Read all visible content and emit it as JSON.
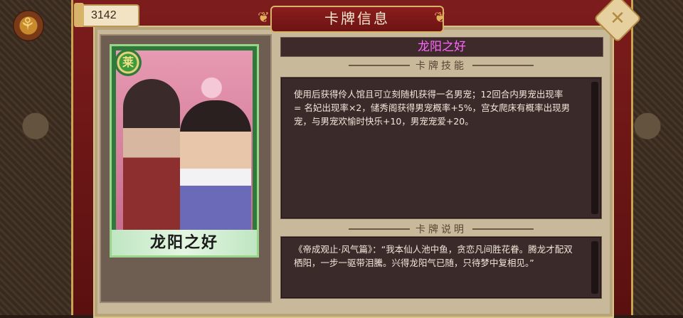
{
  "currency": {
    "amount": "3142"
  },
  "header": {
    "title": "卡牌信息"
  },
  "card": {
    "name": "龙阳之好",
    "badge": "莱",
    "skill_heading": "卡牌技能",
    "skill_text": "使用后获得伶人馆且可立刻随机获得一名男宠；12回合内男宠出现率 = 名妃出现率×2，储秀阁获得男宠概率+5%，宫女爬床有概率出现男宠，与男宠欢愉时快乐+10，男宠宠爱+20。",
    "desc_heading": "卡牌说明",
    "desc_text": "《帝成观止·风气篇》：“我本仙人池中鱼，贪恋凡间胜花眷。腾龙才配双栖阳，一步一驱带泪騰。兴得龙阳气已随，只待梦中复相见。”"
  },
  "colors": {
    "title_name": "#ff66ff",
    "frame_red": "#7d1c1c",
    "card_green": "#2f7a3a"
  },
  "icons": {
    "close": "close-icon",
    "corner": "emblem-icon"
  }
}
